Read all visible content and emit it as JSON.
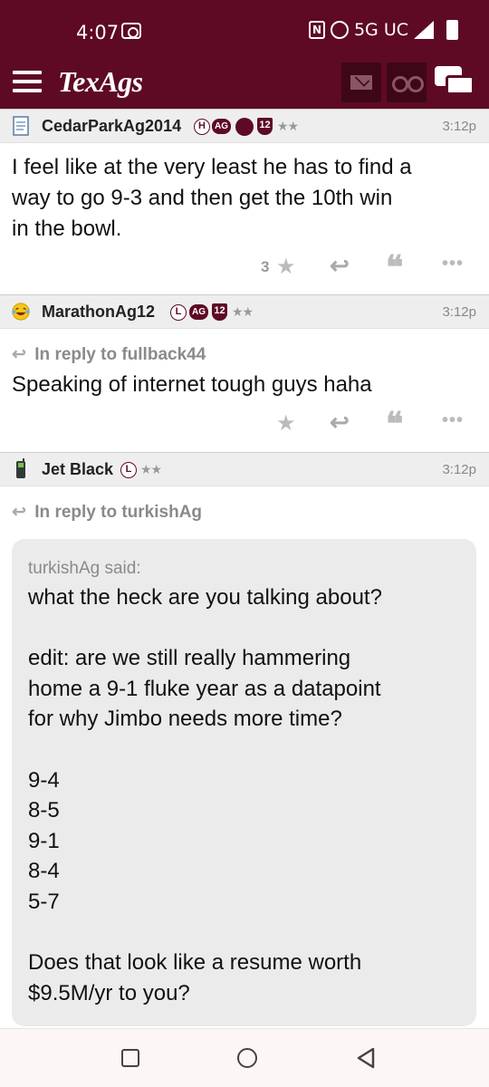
{
  "status_bar": {
    "time": "4:07",
    "network": "5G UC"
  },
  "app": {
    "title": "TexAgs"
  },
  "posts": [
    {
      "username": "CedarParkAg2014",
      "badges": [
        "H",
        "AG",
        "12"
      ],
      "rank_stars": "★★",
      "time": "3:12p",
      "body": [
        "I feel like at the very least he has to find a",
        "way to go 9-3 and then get the 10th win",
        "in the bowl."
      ],
      "star_count": "3"
    },
    {
      "username": "MarathonAg12",
      "badges": [
        "L",
        "AG",
        "12"
      ],
      "rank_stars": "★★",
      "time": "3:12p",
      "reply_to": "In reply to fullback44",
      "body": [
        "Speaking of internet tough guys haha"
      ],
      "star_count": ""
    },
    {
      "username": "Jet Black",
      "badges": [
        "L"
      ],
      "rank_stars": "★★",
      "time": "3:12p",
      "reply_to": "In reply to turkishAg",
      "quote": {
        "author_said": "turkishAg said:",
        "lines": [
          "what the heck are you talking about?",
          "",
          "edit: are we still really hammering",
          "home a 9-1 fluke year as a datapoint",
          "for why Jimbo needs more time?",
          "",
          "9-4",
          "8-5",
          "9-1",
          "8-4",
          "5-7",
          "",
          "Does that look like a resume worth",
          "$9.5M/yr to you?"
        ]
      }
    }
  ],
  "icons": {
    "menu": "hamburger-menu-icon",
    "mail": "mail-icon",
    "binoculars": "binoculars-icon",
    "chat": "chat-bubbles-icon",
    "star": "★",
    "reply": "↩",
    "quote": "❝",
    "more": "•••"
  },
  "colors": {
    "brand": "#5e0a25",
    "header_bg": "#eeeeee",
    "quote_bg": "#ebebeb"
  }
}
